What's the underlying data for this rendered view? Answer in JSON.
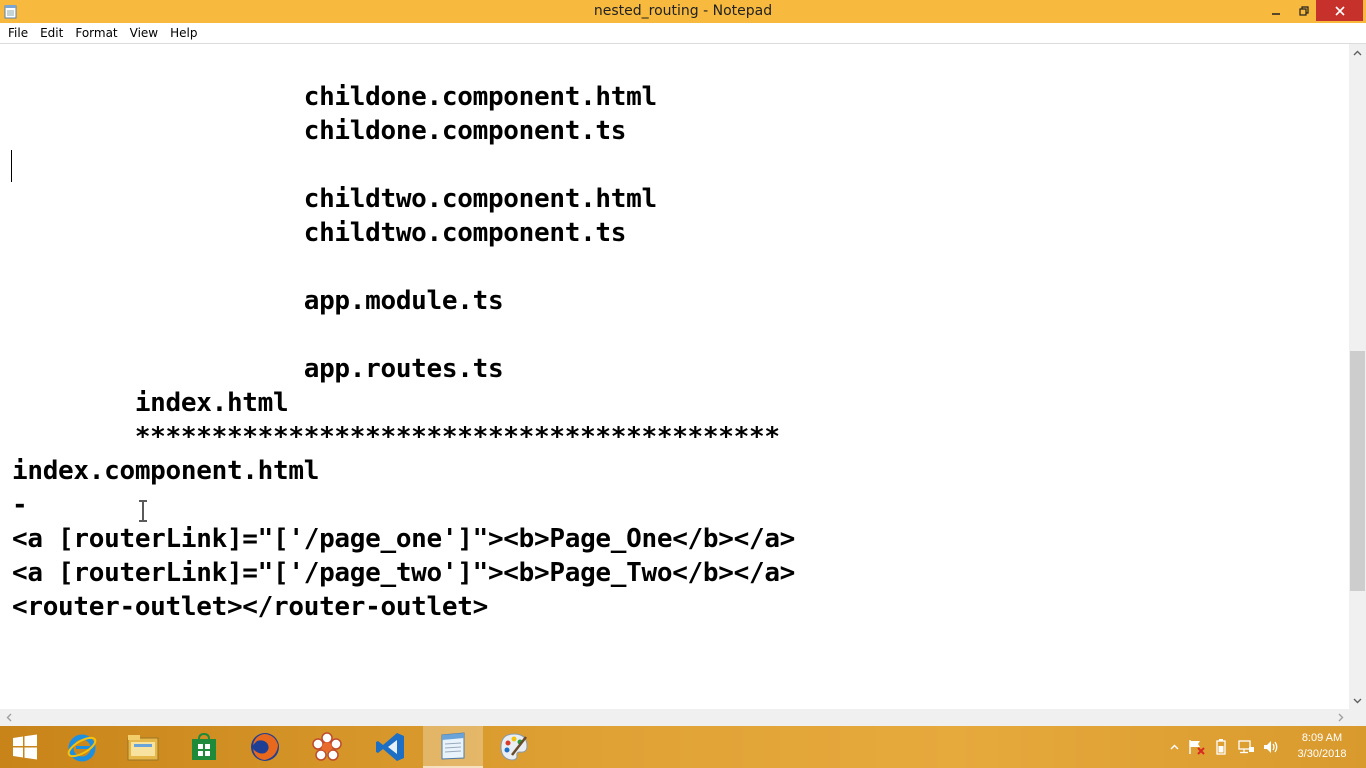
{
  "window": {
    "title": "nested_routing - Notepad",
    "icon": "notepad-icon",
    "buttons": {
      "minimize": "minimize-icon",
      "maximize": "restore-icon",
      "close": "close-icon"
    }
  },
  "menu": [
    "File",
    "Edit",
    "Format",
    "View",
    "Help"
  ],
  "editor": {
    "lines": [
      "                   childone.component.html",
      "                   childone.component.ts",
      "",
      "                   childtwo.component.html",
      "                   childtwo.component.ts",
      "",
      "                   app.module.ts",
      "",
      "                   app.routes.ts",
      "        index.html",
      "        ******************************************",
      "index.component.html",
      "-",
      "<a [routerLink]=\"['/page_one']\"><b>Page_One</b></a>",
      "<a [routerLink]=\"['/page_two']\"><b>Page_Two</b></a>",
      "<router-outlet></router-outlet>"
    ]
  },
  "taskbar": {
    "items": [
      "windows-start-icon",
      "internet-explorer-icon",
      "file-explorer-icon",
      "store-icon",
      "firefox-icon",
      "app-flower-icon",
      "vscode-icon",
      "notepad-icon",
      "paint-icon"
    ],
    "active": "notepad-icon",
    "tray_icons": [
      "show-hidden-icons-chevron",
      "action-center-flag-icon",
      "power-icon",
      "network-icon",
      "volume-icon"
    ],
    "clock": {
      "time": "8:09 AM",
      "date": "3/30/2018"
    }
  },
  "colors": {
    "titlebar": "#f7ba3e",
    "close": "#c7312b",
    "taskbar": "#e0a235"
  }
}
